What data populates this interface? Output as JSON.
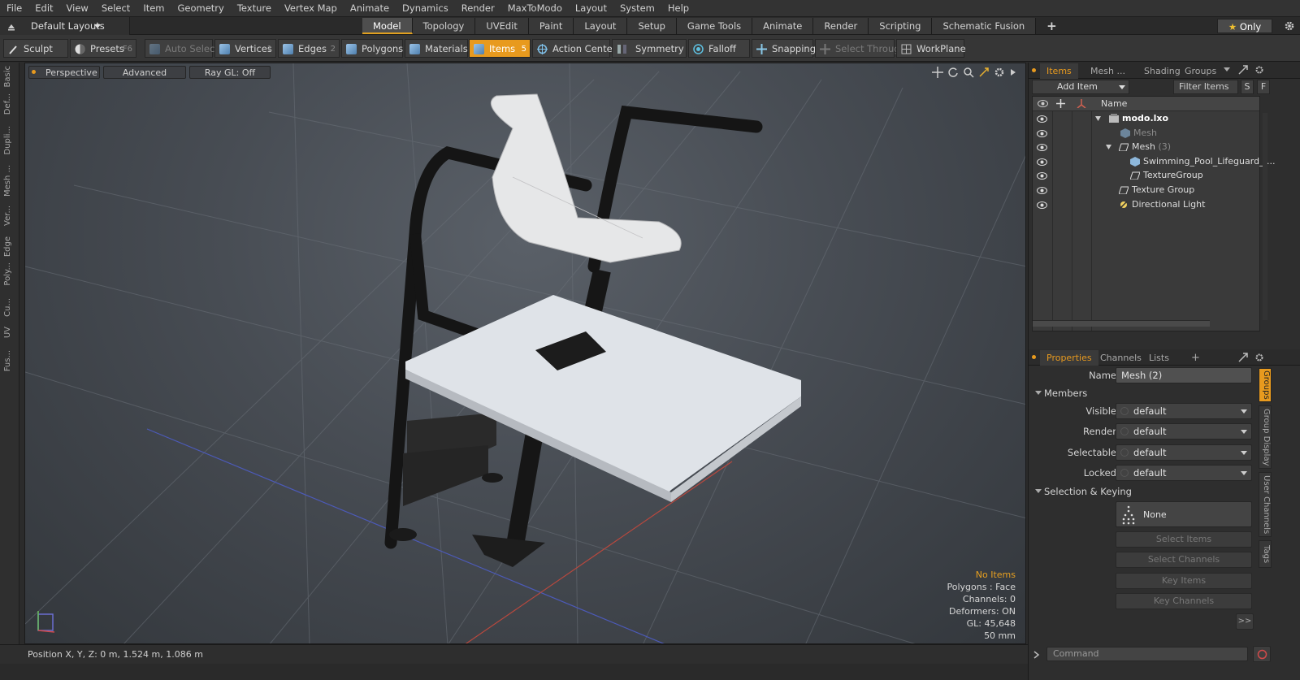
{
  "menu": [
    "File",
    "Edit",
    "View",
    "Select",
    "Item",
    "Geometry",
    "Texture",
    "Vertex Map",
    "Animate",
    "Dynamics",
    "Render",
    "MaxToModo",
    "Layout",
    "System",
    "Help"
  ],
  "layout": {
    "selector": "Default Layouts",
    "tabs": [
      "Model",
      "Topology",
      "UVEdit",
      "Paint",
      "Layout",
      "Setup",
      "Game Tools",
      "Animate",
      "Render",
      "Scripting",
      "Schematic Fusion"
    ],
    "active": "Model",
    "only_label": "Only",
    "add": "+"
  },
  "toolbar": {
    "sculpt": "Sculpt",
    "presets": "Presets",
    "presets_key": "F6",
    "auto_select": "Auto Select",
    "vertices": "Vertices",
    "vertices_n": "1",
    "edges": "Edges",
    "edges_n": "2",
    "polygons": "Polygons",
    "materials": "Materials",
    "items": "Items",
    "items_n": "5",
    "action_center": "Action Center",
    "symmetry": "Symmetry",
    "falloff": "Falloff",
    "snapping": "Snapping",
    "select_through": "Select Through",
    "workplane": "WorkPlane"
  },
  "left_tabs": [
    "Basic",
    "Def...",
    "Dupli...",
    "Mesh ...",
    "Ver...",
    "Edge",
    "Poly...",
    "Cu...",
    "UV",
    "Fus..."
  ],
  "viewport": {
    "perspective": "Perspective",
    "advanced": "Advanced",
    "raygl": "Ray GL: Off",
    "info": {
      "selection": "No Items",
      "polygons": "Polygons : Face",
      "channels": "Channels: 0",
      "deformers": "Deformers: ON",
      "gl": "GL: 45,648",
      "focal": "50 mm"
    },
    "highlight_color": "#e8a020"
  },
  "status": {
    "position": "Position X, Y, Z:  0 m, 1.524 m, 1.086 m"
  },
  "items_panel": {
    "tabs": [
      "Items",
      "Mesh ...",
      "Shading",
      "Groups"
    ],
    "add_item": "Add Item",
    "filter": "Filter Items",
    "s": "S",
    "f": "F",
    "column": "Name",
    "tree": [
      {
        "label": "modo.lxo",
        "indent": 0,
        "bold": true
      },
      {
        "label": "Mesh",
        "indent": 1,
        "dim": true
      },
      {
        "label": "Mesh",
        "suffix": "(3)",
        "indent": 1
      },
      {
        "label": "Swimming_Pool_Lifeguard_ ...",
        "indent": 2
      },
      {
        "label": "TextureGroup",
        "indent": 2
      },
      {
        "label": "Texture Group",
        "indent": 1
      },
      {
        "label": "Directional Light",
        "indent": 1
      }
    ]
  },
  "properties_panel": {
    "tabs": [
      "Properties",
      "Channels",
      "Lists"
    ],
    "name_label": "Name",
    "name_value": "Mesh (2)",
    "members": "Members",
    "rows": [
      {
        "label": "Visible",
        "value": "default"
      },
      {
        "label": "Render",
        "value": "default"
      },
      {
        "label": "Selectable",
        "value": "default"
      },
      {
        "label": "Locked",
        "value": "default"
      }
    ],
    "selection_keying": "Selection & Keying",
    "none": "None",
    "buttons": [
      "Select Items",
      "Select Channels",
      "Key Items",
      "Key Channels"
    ],
    "more": ">>",
    "side_tabs": [
      "Groups",
      "Group Display",
      "User Channels",
      "Tags"
    ]
  },
  "command": {
    "placeholder": "Command"
  }
}
